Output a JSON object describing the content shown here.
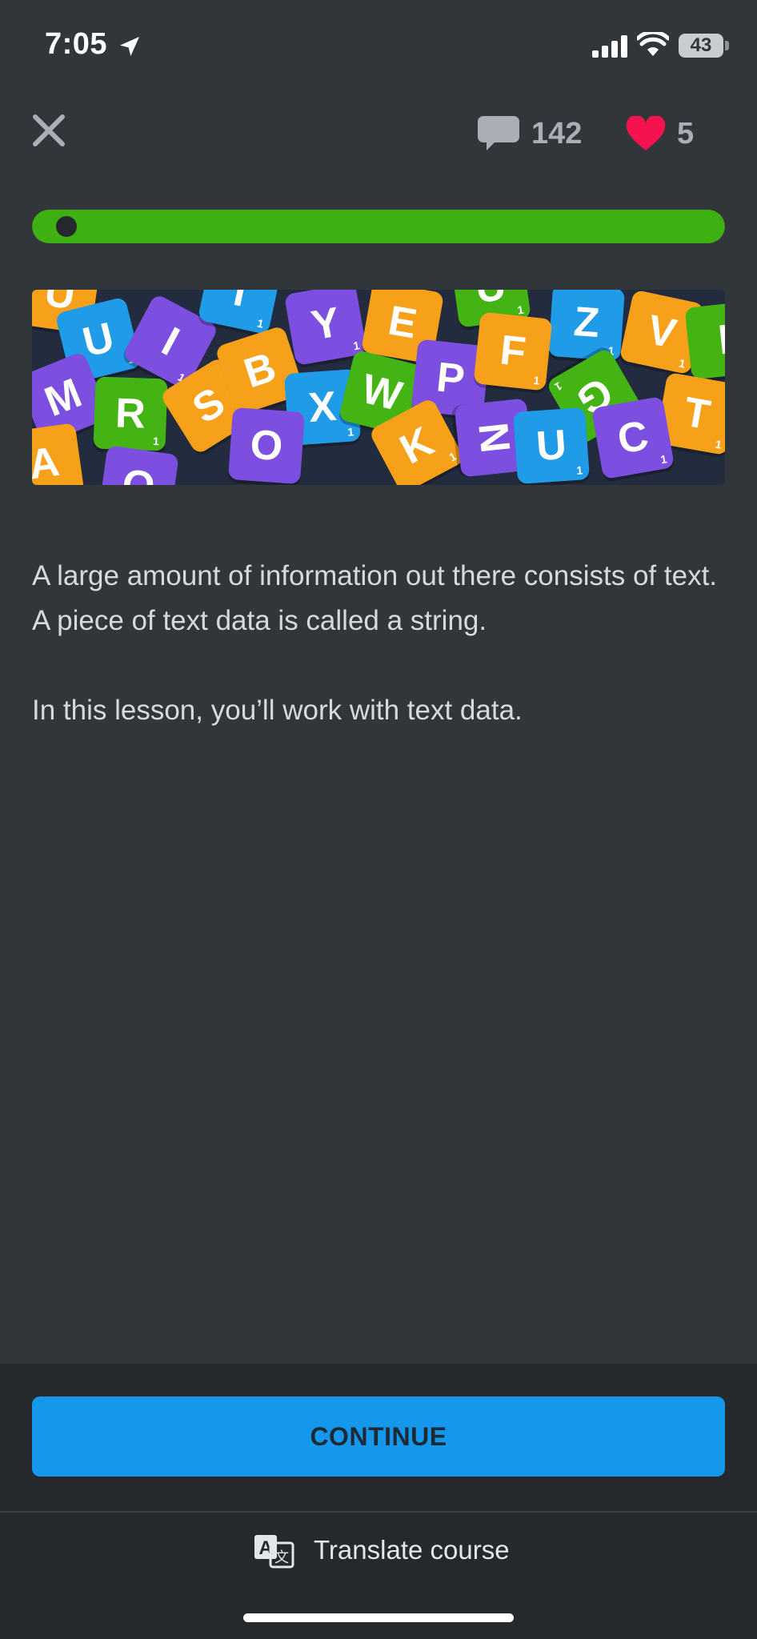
{
  "status_bar": {
    "time": "7:05",
    "battery_level": "43",
    "icons": [
      "location-arrow-icon",
      "cellular-signal-icon",
      "wifi-icon",
      "battery-icon"
    ]
  },
  "top_bar": {
    "close_icon": "close-icon",
    "comments_icon": "speech-bubble-icon",
    "comments_count": "142",
    "hearts_icon": "heart-icon",
    "hearts_count": "5"
  },
  "progress": {
    "fraction": 1.0,
    "fill_color": "#3fb011"
  },
  "banner": {
    "description_icon": "letter-tiles-illustration",
    "tiles": [
      "U",
      "I",
      "Y",
      "E",
      "U",
      "Z",
      "V",
      "M",
      "R",
      "S",
      "B",
      "X",
      "W",
      "P",
      "F",
      "G",
      "T",
      "A",
      "O",
      "O",
      "K",
      "N",
      "U",
      "C",
      "I"
    ],
    "tile_point_value": "1",
    "colors": {
      "orange": "#f7a11b",
      "purple": "#7c4fe0",
      "blue": "#1f9be8",
      "green": "#43b414"
    }
  },
  "lesson": {
    "paragraph_1": "A large amount of information out there consists of text. A piece of text data is called a string.",
    "paragraph_2": "In this lesson, you’ll work with text data."
  },
  "footer": {
    "continue_label": "CONTINUE",
    "continue_color": "#1598ec",
    "translate_icon": "translate-icon",
    "translate_label": "Translate course"
  },
  "colors": {
    "background": "#30363a",
    "heart": "#f5124e"
  }
}
